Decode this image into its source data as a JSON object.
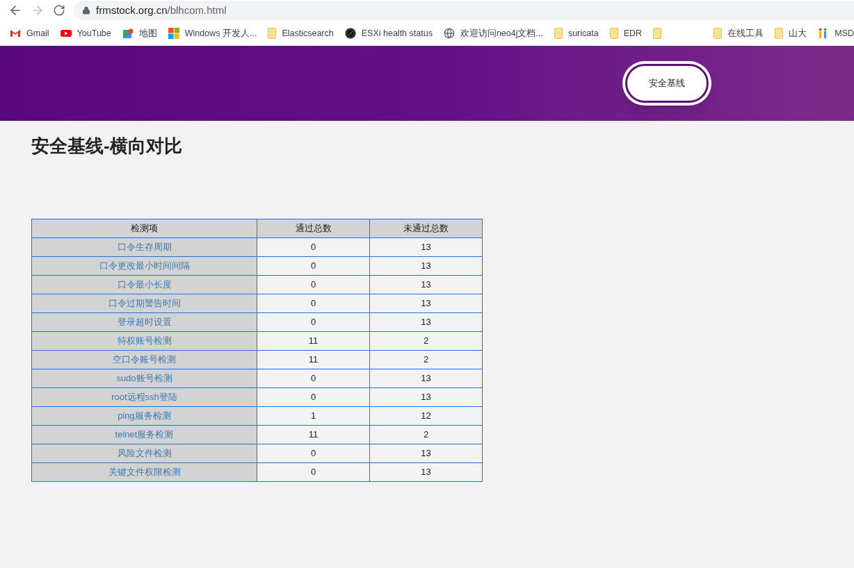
{
  "browser": {
    "url_host": "frmstock.org.cn",
    "url_path": "/blhcom.html",
    "bookmarks": [
      {
        "kind": "gmail",
        "label": "Gmail"
      },
      {
        "kind": "youtube",
        "label": "YouTube"
      },
      {
        "kind": "maps",
        "label": "地图"
      },
      {
        "kind": "windows",
        "label": "Windows 开发人..."
      },
      {
        "kind": "folder",
        "label": "Elasticsearch"
      },
      {
        "kind": "esxi",
        "label": "ESXi health status"
      },
      {
        "kind": "globe",
        "label": "欢迎访问neo4j文档..."
      },
      {
        "kind": "folder",
        "label": "suricata"
      },
      {
        "kind": "folder",
        "label": "EDR"
      },
      {
        "kind": "folder"
      },
      {
        "kind": "spacer"
      },
      {
        "kind": "folder",
        "label": "在线工具"
      },
      {
        "kind": "folder",
        "label": "山大"
      },
      {
        "kind": "app",
        "label": "MSD"
      }
    ]
  },
  "header": {
    "button": "安全基线"
  },
  "title": "安全基线-横向对比",
  "table": {
    "columns": [
      "检测项",
      "通过总数",
      "未通过总数"
    ],
    "rows": [
      [
        "口令生存周期",
        "0",
        "13"
      ],
      [
        "口令更改最小时间间隔",
        "0",
        "13"
      ],
      [
        "口令最小长度",
        "0",
        "13"
      ],
      [
        "口令过期警告时间",
        "0",
        "13"
      ],
      [
        "登录超时设置",
        "0",
        "13"
      ],
      [
        "特权账号检测",
        "11",
        "2"
      ],
      [
        "空口令账号检测",
        "11",
        "2"
      ],
      [
        "sudo账号检测",
        "0",
        "13"
      ],
      [
        "root远程ssh登陆",
        "0",
        "13"
      ],
      [
        "ping服务检测",
        "1",
        "12"
      ],
      [
        "telnet服务检测",
        "11",
        "2"
      ],
      [
        "风险文件检测",
        "0",
        "13"
      ],
      [
        "关键文件权限检测",
        "0",
        "13"
      ]
    ]
  }
}
